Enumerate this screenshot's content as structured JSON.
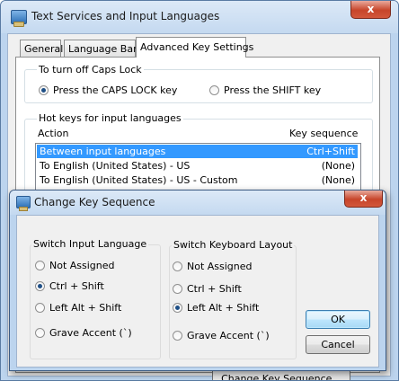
{
  "main_window": {
    "title": "Text Services and Input Languages",
    "close_glyph": "x",
    "tabs": [
      {
        "label": "General",
        "active": false
      },
      {
        "label": "Language Bar",
        "active": false
      },
      {
        "label": "Advanced Key Settings",
        "active": true
      }
    ],
    "caps_lock": {
      "group_label": "To turn off Caps Lock",
      "options": [
        {
          "label": "Press the CAPS LOCK key",
          "selected": true
        },
        {
          "label": "Press the SHIFT key",
          "selected": false
        }
      ]
    },
    "hotkeys": {
      "group_label": "Hot keys for input languages",
      "col_action": "Action",
      "col_key_sequence": "Key sequence",
      "rows": [
        {
          "action": "Between input languages",
          "sequence": "Ctrl+Shift",
          "selected": true
        },
        {
          "action": "To English (United States) - US",
          "sequence": "(None)",
          "selected": false
        },
        {
          "action": "To English (United States) - US - Custom",
          "sequence": "(None)",
          "selected": false
        }
      ]
    },
    "change_key_sequence_button": "Change Key Sequence..."
  },
  "dialog": {
    "title": "Change Key Sequence",
    "close_glyph": "x",
    "switch_input_language": {
      "label": "Switch Input Language",
      "options": [
        {
          "label": "Not Assigned",
          "selected": false
        },
        {
          "label": "Ctrl + Shift",
          "selected": true
        },
        {
          "label": "Left Alt + Shift",
          "selected": false
        },
        {
          "label": "Grave Accent (`)",
          "selected": false
        }
      ]
    },
    "switch_keyboard_layout": {
      "label": "Switch Keyboard Layout",
      "options": [
        {
          "label": "Not Assigned",
          "selected": false
        },
        {
          "label": "Ctrl + Shift",
          "selected": false
        },
        {
          "label": "Left Alt + Shift",
          "selected": true
        },
        {
          "label": "Grave Accent (`)",
          "selected": false
        }
      ]
    },
    "ok_label": "OK",
    "cancel_label": "Cancel"
  },
  "colors": {
    "selection": "#3399ff",
    "window_frame": "#bcd4ee",
    "close_button": "#c7452a",
    "radio_dot": "#1e4f86"
  }
}
